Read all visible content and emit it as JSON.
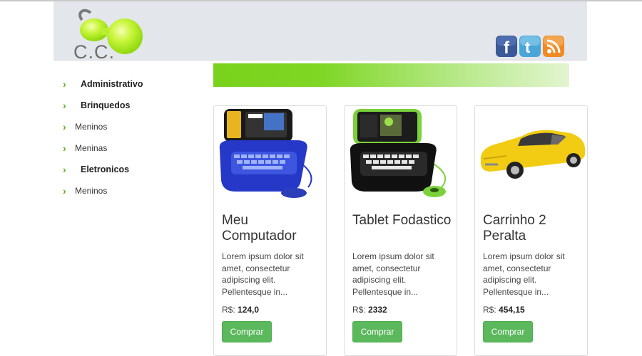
{
  "header": {
    "logo_text": "C.C.",
    "social": [
      {
        "name": "facebook",
        "glyph": "f",
        "color": "#3b5998"
      },
      {
        "name": "twitter",
        "glyph": "t",
        "color": "#4ba6d8"
      },
      {
        "name": "rss",
        "glyph": "rss",
        "color": "#f08a24"
      }
    ]
  },
  "sidebar": {
    "items": [
      {
        "label": "Administrativo",
        "type": "category"
      },
      {
        "label": "Brinquedos",
        "type": "category"
      },
      {
        "label": "Meninos",
        "type": "sub"
      },
      {
        "label": "Meninas",
        "type": "sub"
      },
      {
        "label": "Eletronicos",
        "type": "category"
      },
      {
        "label": "Meninos",
        "type": "sub"
      }
    ]
  },
  "colors": {
    "accent_green": "#79d21c",
    "button_green": "#5cb85c"
  },
  "products": [
    {
      "title": "Meu Computador",
      "description": "Lorem ipsum dolor sit amet, consectetur adipiscing elit. Pellentesque in...",
      "price_prefix": "R$:",
      "price": "124,0",
      "button": "Comprar",
      "image": "blue-toy-laptop"
    },
    {
      "title": "Tablet Fodastico",
      "description": "Lorem ipsum dolor sit amet, consectetur adipiscing elit. Pellentesque in...",
      "price_prefix": "R$:",
      "price": "2332",
      "button": "Comprar",
      "image": "black-green-toy-laptop"
    },
    {
      "title": "Carrinho 2 Peralta",
      "description": "Lorem ipsum dolor sit amet, consectetur adipiscing elit. Pellentesque in...",
      "price_prefix": "R$:",
      "price": "454,15",
      "button": "Comprar",
      "image": "yellow-toy-car"
    }
  ]
}
